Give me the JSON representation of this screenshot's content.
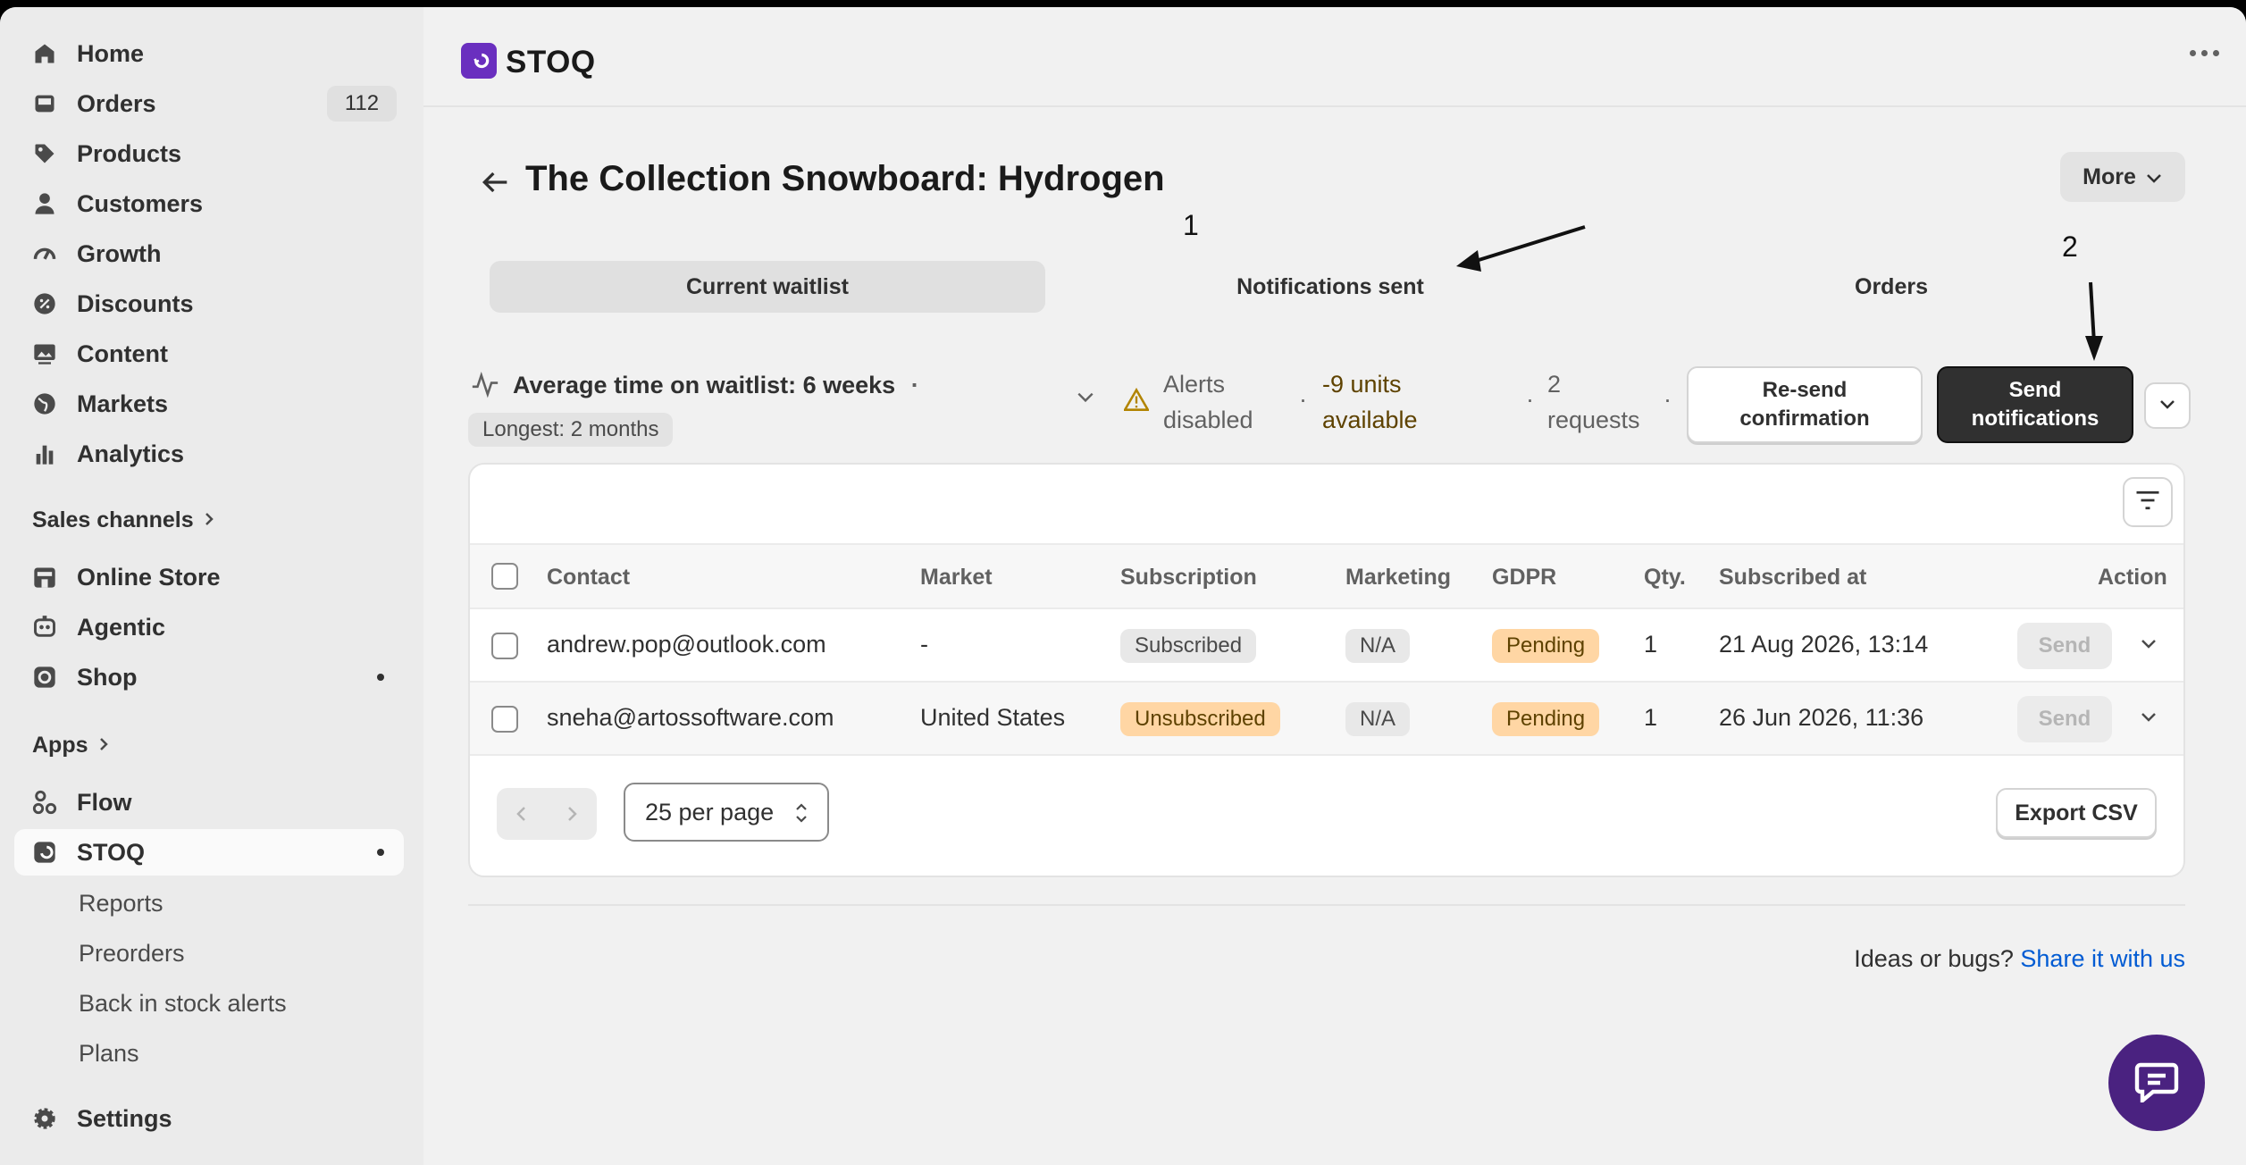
{
  "sidebar": {
    "items": [
      {
        "label": "Home",
        "icon": "home-icon"
      },
      {
        "label": "Orders",
        "icon": "inbox-icon",
        "badge": "112"
      },
      {
        "label": "Products",
        "icon": "tag-icon"
      },
      {
        "label": "Customers",
        "icon": "person-icon"
      },
      {
        "label": "Growth",
        "icon": "gauge-icon"
      },
      {
        "label": "Discounts",
        "icon": "discount-icon"
      },
      {
        "label": "Content",
        "icon": "image-icon"
      },
      {
        "label": "Markets",
        "icon": "globe-icon"
      },
      {
        "label": "Analytics",
        "icon": "bar-chart-icon"
      }
    ],
    "sales_channels_heading": "Sales channels",
    "channels": [
      {
        "label": "Online Store",
        "icon": "store-icon"
      },
      {
        "label": "Agentic",
        "icon": "agent-icon"
      },
      {
        "label": "Shop",
        "icon": "shop-icon"
      }
    ],
    "apps_heading": "Apps",
    "apps": [
      {
        "label": "Flow",
        "icon": "flow-icon"
      },
      {
        "label": "STOQ",
        "icon": "stoq-icon"
      }
    ],
    "stoq_subitems": [
      "Reports",
      "Preorders",
      "Back in stock alerts",
      "Plans"
    ],
    "settings_label": "Settings"
  },
  "topbar": {
    "app_name": "STOQ"
  },
  "page": {
    "title": "The Collection Snowboard: Hydrogen",
    "more_label": "More",
    "annotation_1": "1",
    "annotation_2": "2"
  },
  "tabs": [
    {
      "label": "Current waitlist",
      "active": true
    },
    {
      "label": "Notifications sent",
      "active": false
    },
    {
      "label": "Orders",
      "active": false
    }
  ],
  "stats": {
    "avg_time": "Average time on waitlist: 6 weeks",
    "avg_sep": "·",
    "longest": "Longest: 2 months",
    "alerts_line1": "Alerts",
    "alerts_line2": "disabled",
    "units_line1": "-9 units",
    "units_line2": "available",
    "requests_line1": "2",
    "requests_line2": "requests",
    "resend_line1": "Re-send",
    "resend_line2": "confirmation",
    "send_line1": "Send",
    "send_line2": "notifications"
  },
  "table": {
    "columns": [
      "Contact",
      "Market",
      "Subscription",
      "Marketing",
      "GDPR",
      "Qty.",
      "Subscribed at",
      "Action"
    ],
    "rows": [
      {
        "contact": "andrew.pop@outlook.com",
        "market": "-",
        "subscription": "Subscribed",
        "marketing": "N/A",
        "gdpr": "Pending",
        "qty": "1",
        "subscribed_at": "21 Aug 2026, 13:14",
        "action": "Send"
      },
      {
        "contact": "sneha@artossoftware.com",
        "market": "United States",
        "subscription": "Unsubscribed",
        "marketing": "N/A",
        "gdpr": "Pending",
        "qty": "1",
        "subscribed_at": "26 Jun 2026, 11:36",
        "action": "Send"
      }
    ],
    "per_page": "25 per page",
    "export_label": "Export CSV"
  },
  "footer": {
    "text": "Ideas or bugs?",
    "link": "Share it with us"
  },
  "colors": {
    "accent_purple": "#6a2fbf",
    "primary_button": "#303030",
    "pending_badge": "#ffd6a4",
    "link": "#005bd3"
  }
}
